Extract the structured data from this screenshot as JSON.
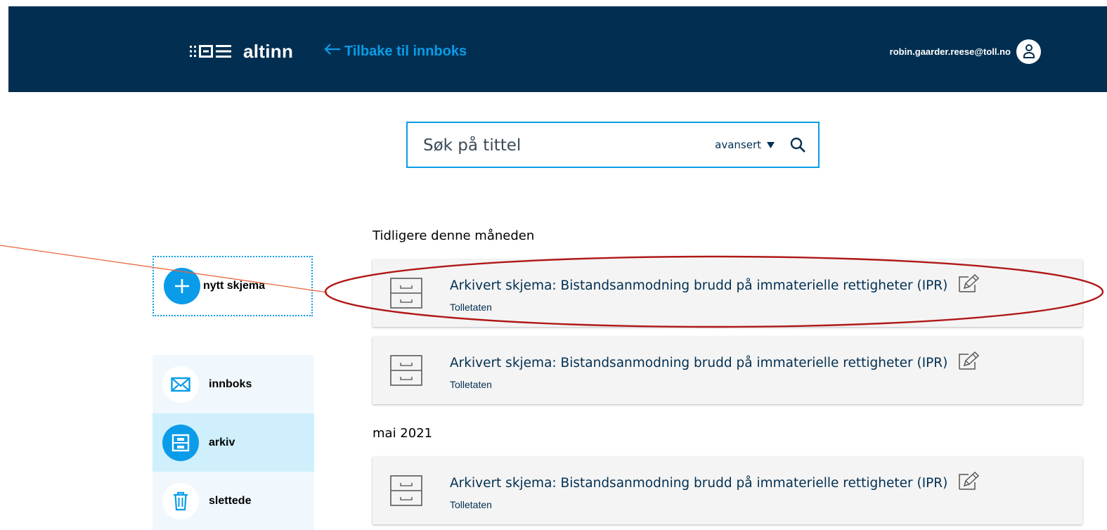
{
  "header": {
    "logo_text": "altinn",
    "back_link": "Tilbake til innboks",
    "user_email": "robin.gaarder.reese@toll.no"
  },
  "search": {
    "placeholder": "Søk på tittel",
    "advanced_label": "avansert"
  },
  "sidebar": {
    "new_form_label": "nytt skjema",
    "items": [
      {
        "label": "innboks",
        "icon": "envelope-icon"
      },
      {
        "label": "arkiv",
        "icon": "archive-icon",
        "active": true
      },
      {
        "label": "slettede",
        "icon": "trash-icon"
      }
    ]
  },
  "sections": [
    {
      "title": "Tidligere denne måneden",
      "items": [
        {
          "title": "Arkivert skjema: Bistandsanmodning brudd på immaterielle rettigheter (IPR)",
          "sender": "Tolletaten"
        },
        {
          "title": "Arkivert skjema: Bistandsanmodning brudd på immaterielle rettigheter (IPR)",
          "sender": "Tolletaten"
        }
      ]
    },
    {
      "title": "mai 2021",
      "items": [
        {
          "title": "Arkivert skjema: Bistandsanmodning brudd på immaterielle rettigheter (IPR)",
          "sender": "Tolletaten"
        }
      ]
    }
  ],
  "colors": {
    "header_bg": "#022f51",
    "accent": "#0a9ce8",
    "annotation_line": "#e8643c",
    "annotation_ellipse": "#b01818"
  }
}
